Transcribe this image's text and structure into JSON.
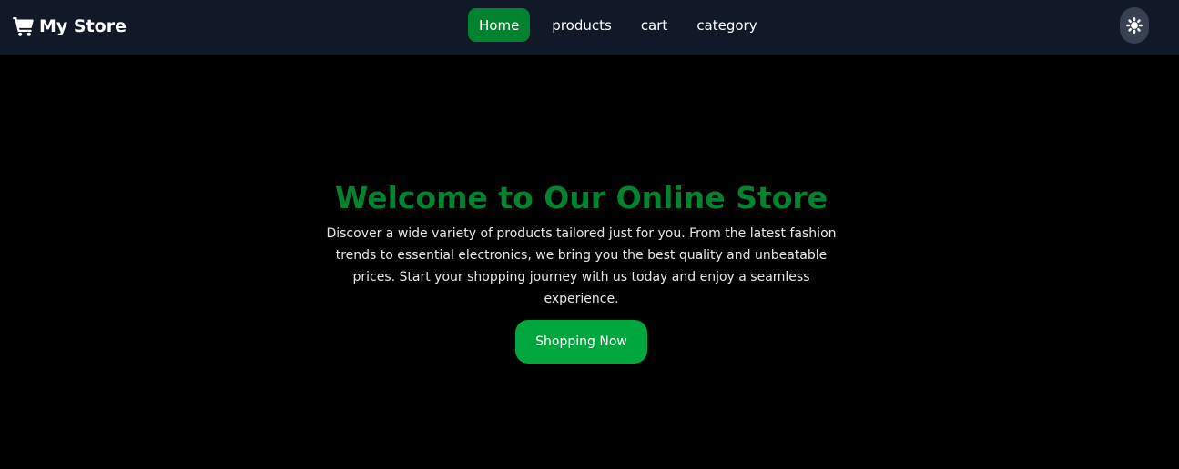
{
  "navbar": {
    "brand": {
      "icon": "shopping-cart-icon",
      "label": "My Store"
    },
    "links": [
      {
        "label": "Home",
        "active": true
      },
      {
        "label": "products",
        "active": false
      },
      {
        "label": "cart",
        "active": false
      },
      {
        "label": "category",
        "active": false
      }
    ],
    "theme_toggle": {
      "icon": "sun-icon"
    }
  },
  "hero": {
    "title": "Welcome to Our Online Store",
    "description": "Discover a wide variety of products tailored just for you. From the latest fashion trends to essential electronics, we bring you the best quality and unbeatable prices. Start your shopping journey with us today and enjoy a seamless experience.",
    "cta_label": "Shopping Now"
  },
  "colors": {
    "navbar_bg": "#111827",
    "page_bg": "#000000",
    "accent_green": "#03832f",
    "button_green": "#00a63e",
    "toggle_bg": "#374151"
  }
}
